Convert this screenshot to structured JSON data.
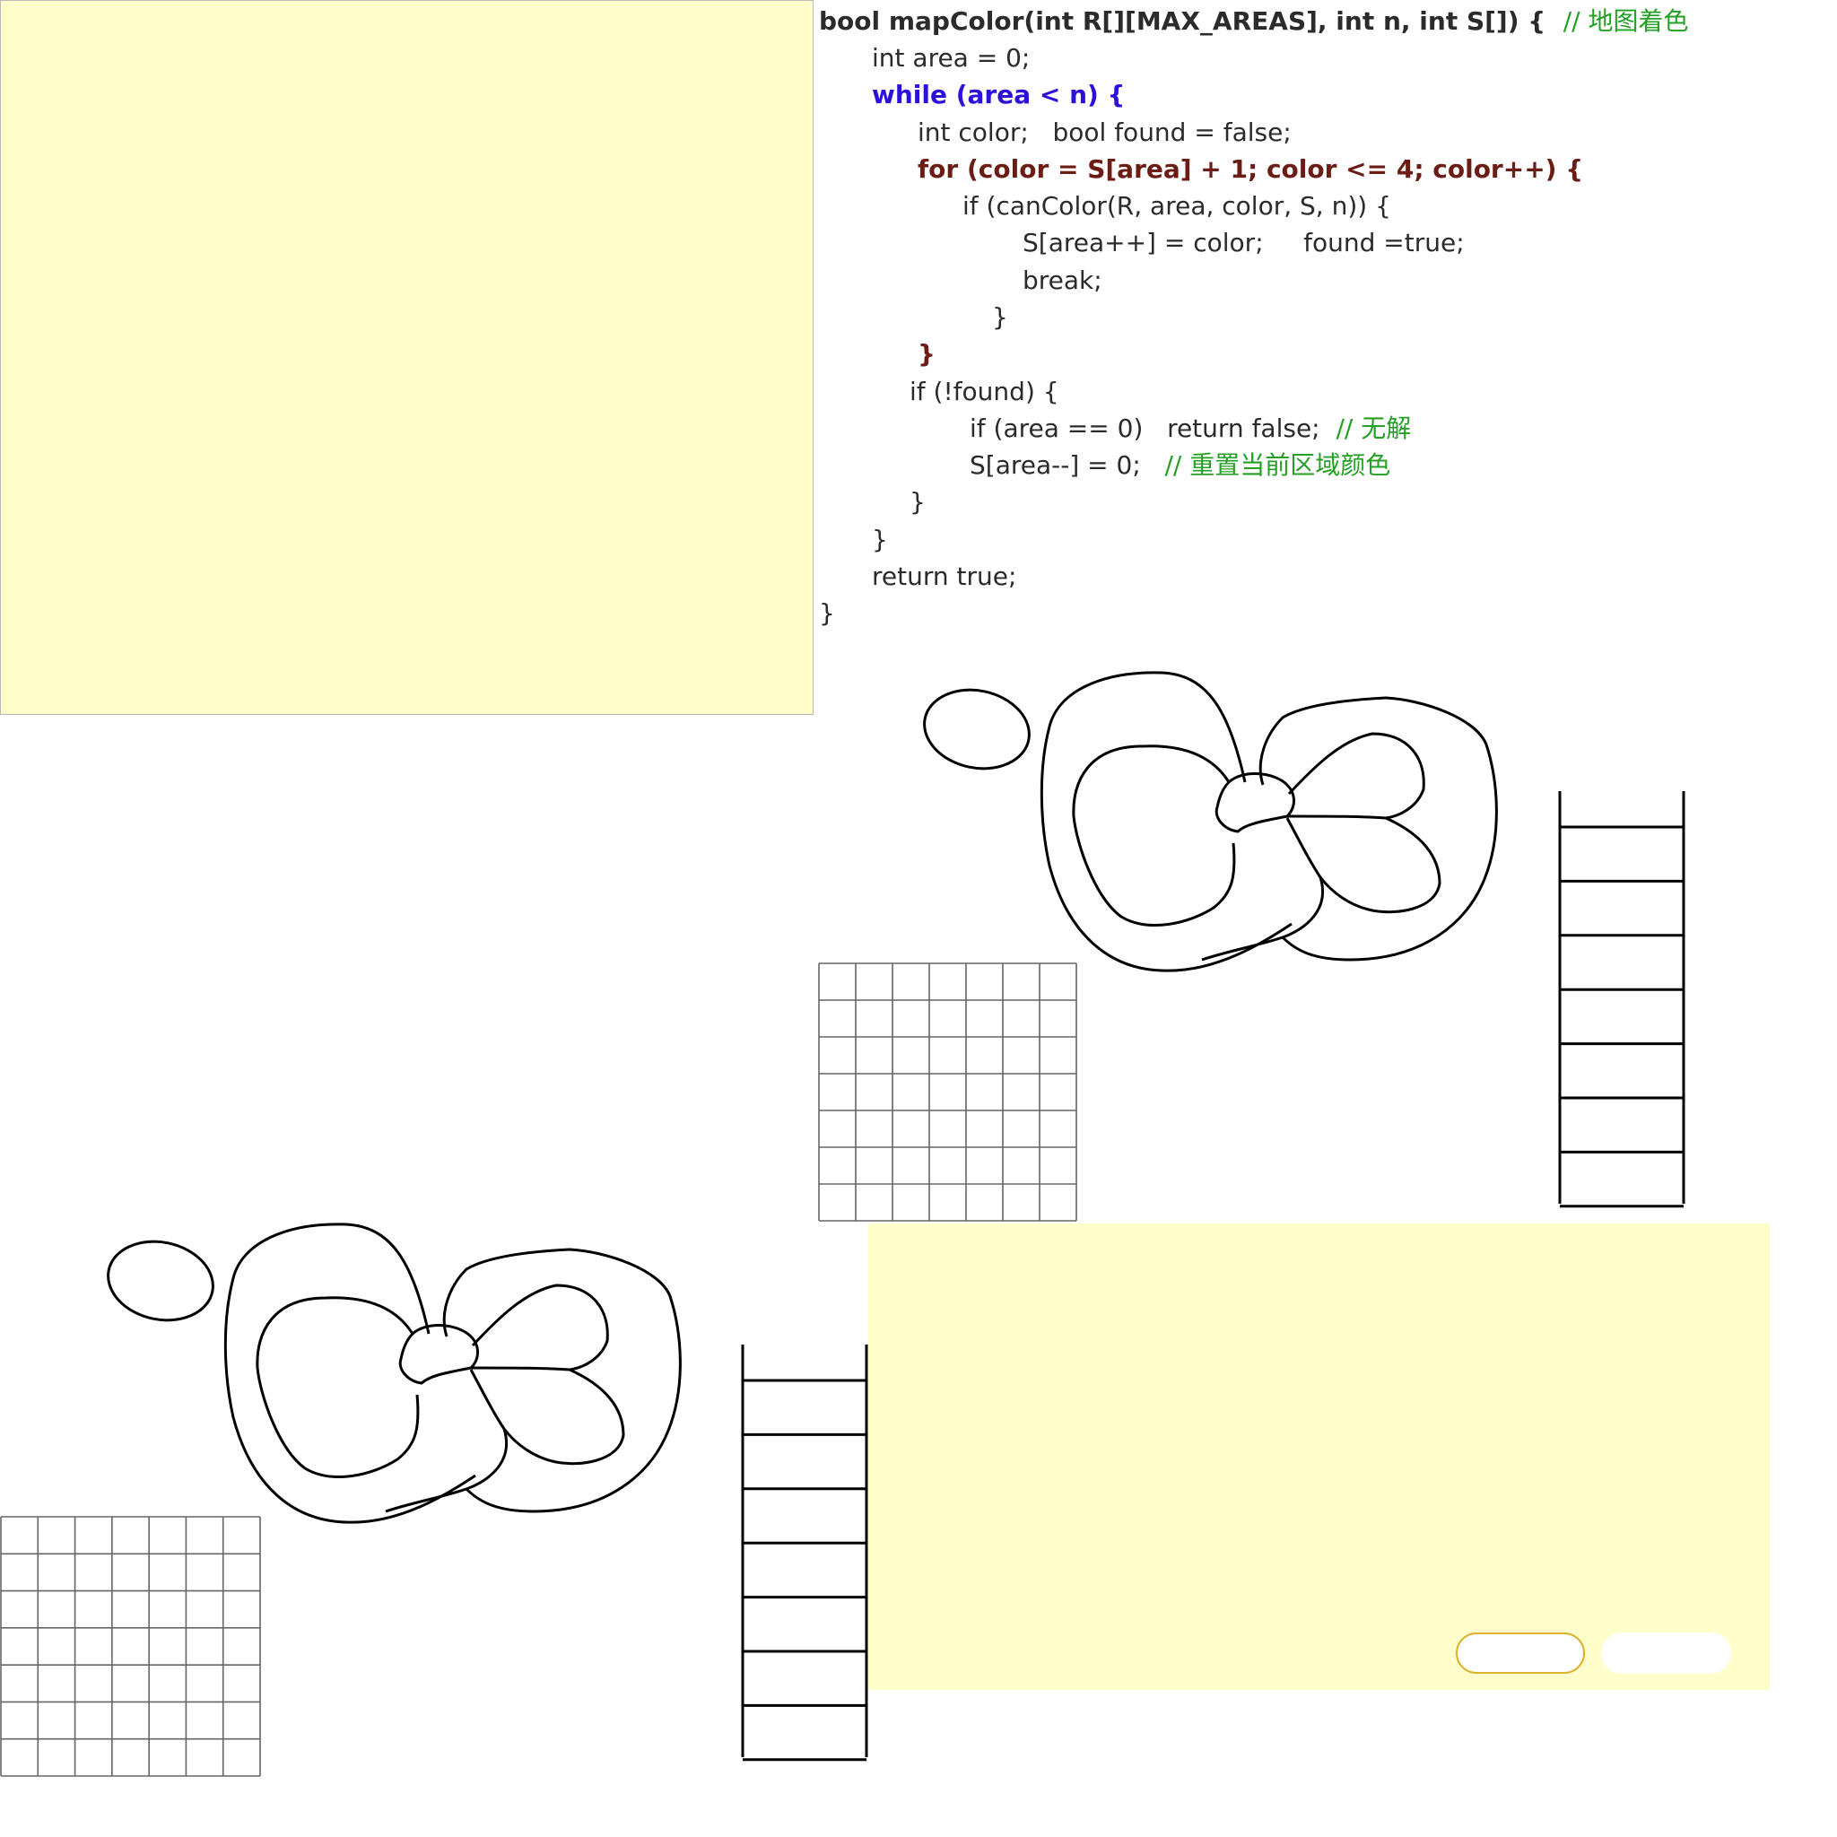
{
  "code": {
    "l1_a": "bool mapColor(int R[][MAX_AREAS], int n, int S[]) {",
    "l1_c": "// 地图着色",
    "l2": "int area = 0;",
    "l3": "while (area < n) {",
    "l4": "int color;   bool found = false;",
    "l5": "for (color = S[area] + 1; color <= 4; color++) {",
    "l6": "if (canColor(R, area, color, S, n)) {",
    "l7": "S[area++] = color;     found =true;",
    "l8": "break;",
    "l9": "}",
    "l10": "}",
    "l11": "if (!found) {",
    "l12_a": "if (area == 0)   return false;",
    "l12_c": "// 无解",
    "l13_a": "S[area--] = 0;",
    "l13_c": "// 重置当前区域颜色",
    "l14": "}",
    "l15": "}",
    "l16": "return true;",
    "l17": "}"
  },
  "colors": {
    "panel": "#ffffcc",
    "keyword_while": "#2c12d9",
    "keyword_for": "#6b1d15",
    "comment": "#24a024",
    "button_border": "#d9b12a"
  },
  "buttons": {
    "first_label": "",
    "second_label": ""
  }
}
